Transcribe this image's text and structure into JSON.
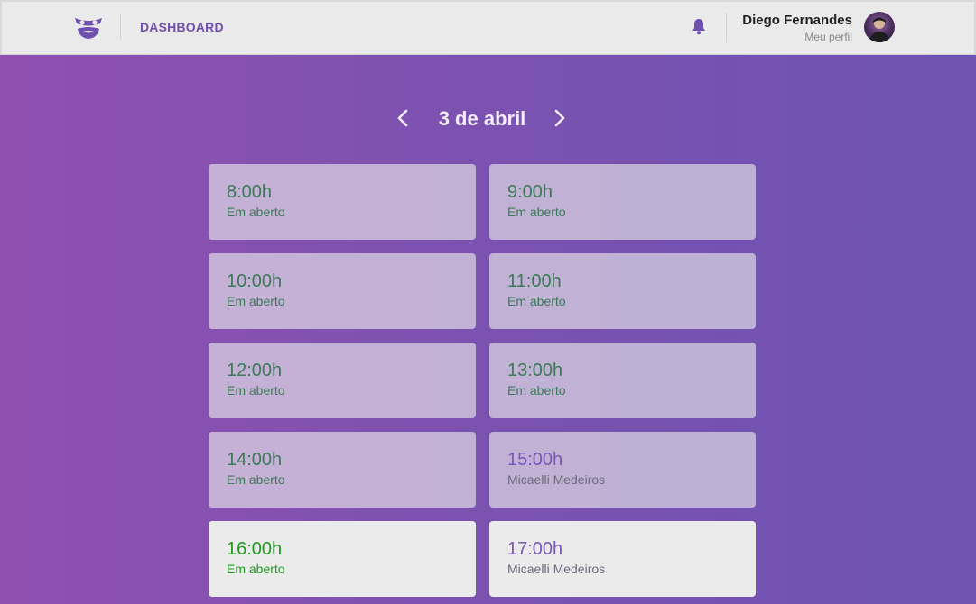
{
  "header": {
    "nav_label": "DASHBOARD",
    "user_name": "Diego Fernandes",
    "user_sub": "Meu perfil"
  },
  "date_nav": {
    "label": "3 de abril"
  },
  "slots": [
    {
      "time": "8:00h",
      "status": "Em aberto"
    },
    {
      "time": "9:00h",
      "status": "Em aberto"
    },
    {
      "time": "10:00h",
      "status": "Em aberto"
    },
    {
      "time": "11:00h",
      "status": "Em aberto"
    },
    {
      "time": "12:00h",
      "status": "Em aberto"
    },
    {
      "time": "13:00h",
      "status": "Em aberto"
    },
    {
      "time": "14:00h",
      "status": "Em aberto"
    },
    {
      "time": "15:00h",
      "status": "Micaelli Medeiros"
    },
    {
      "time": "16:00h",
      "status": "Em aberto"
    },
    {
      "time": "17:00h",
      "status": "Micaelli Medeiros"
    }
  ],
  "colors": {
    "accent": "#6f4fb0",
    "open": "#3c7a58",
    "open_highlight": "#1f9a1f"
  }
}
